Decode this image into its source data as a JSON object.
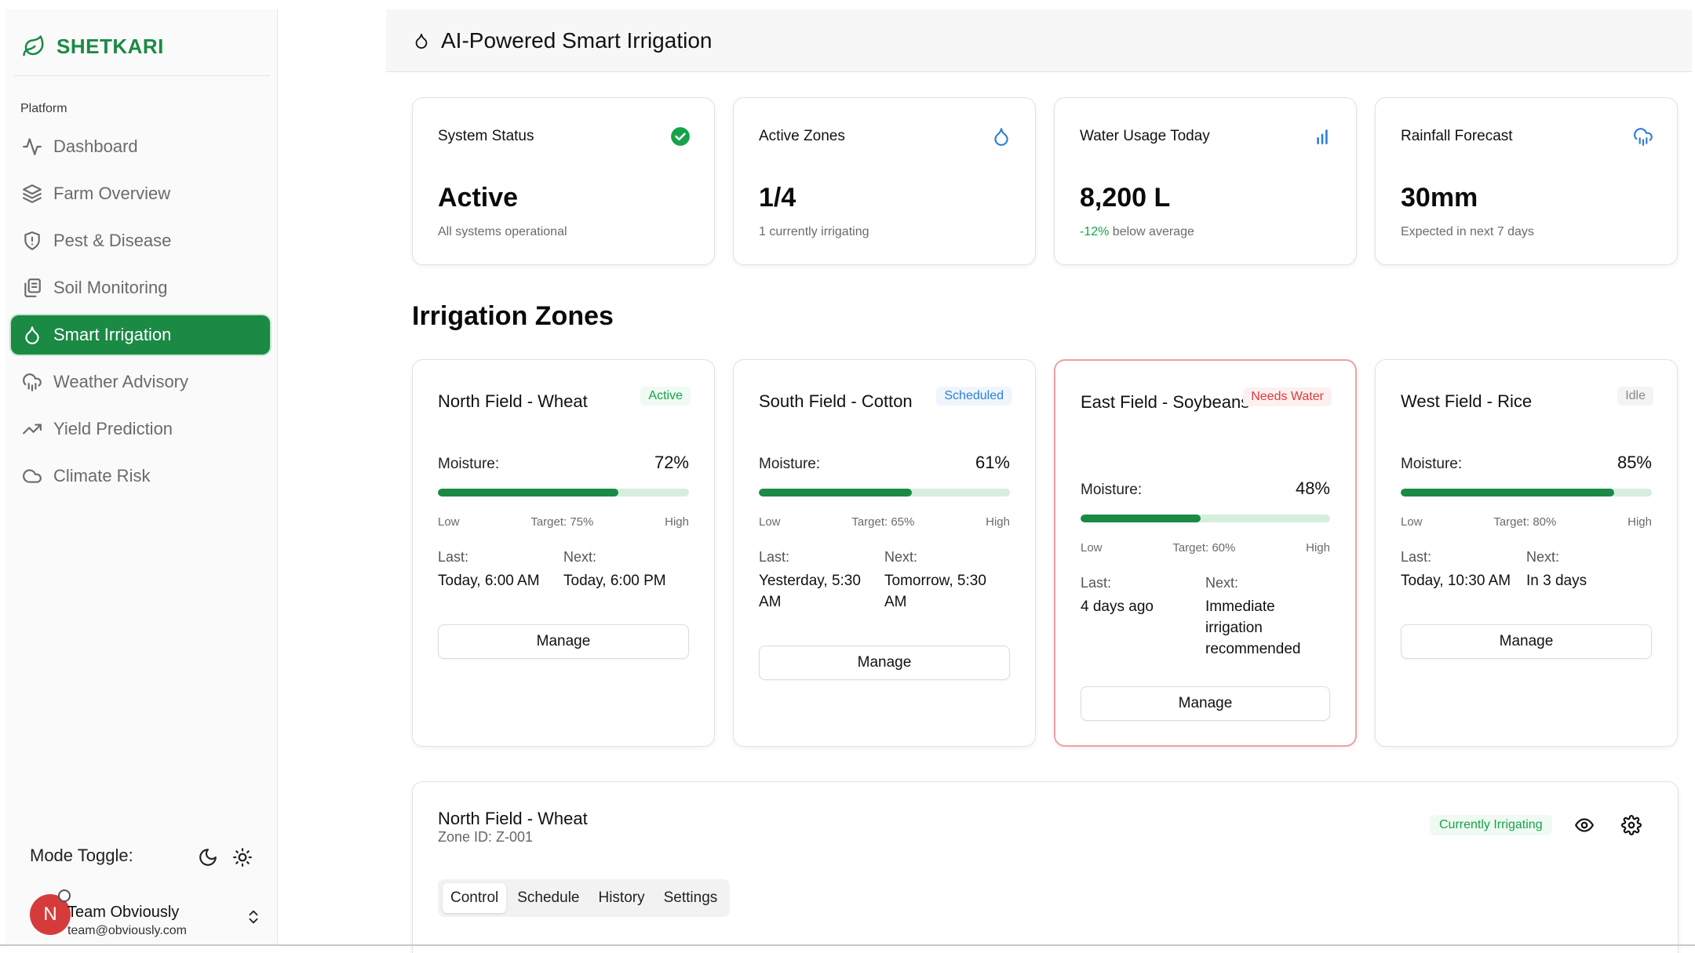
{
  "brand": {
    "name": "SHETKARI",
    "icon": "leaf-icon",
    "color": "#1a8a44"
  },
  "sidebar": {
    "group_label": "Platform",
    "items": [
      {
        "label": "Dashboard",
        "icon": "activity-icon"
      },
      {
        "label": "Farm Overview",
        "icon": "layers-icon"
      },
      {
        "label": "Pest & Disease",
        "icon": "shield-icon"
      },
      {
        "label": "Soil Monitoring",
        "icon": "copy-icon"
      },
      {
        "label": "Smart Irrigation",
        "icon": "droplet-icon",
        "active": true
      },
      {
        "label": "Weather Advisory",
        "icon": "cloud-rain-icon"
      },
      {
        "label": "Yield Prediction",
        "icon": "trending-up-icon"
      },
      {
        "label": "Climate Risk",
        "icon": "cloud-icon"
      }
    ],
    "mode_toggle_label": "Mode Toggle:",
    "user": {
      "initial": "N",
      "name": "Team Obviously",
      "email": "team@obviously.com"
    }
  },
  "header": {
    "title": "AI-Powered Smart Irrigation",
    "icon": "droplet-icon"
  },
  "stats": [
    {
      "title": "System Status",
      "value": "Active",
      "sub": "All systems operational",
      "icon": "check-circle-icon",
      "icon_color": "#16a34a"
    },
    {
      "title": "Active Zones",
      "value": "1/4",
      "sub": "1 currently irrigating",
      "icon": "droplet-icon",
      "icon_color": "#2f7fd4"
    },
    {
      "title": "Water Usage Today",
      "value": "8,200 L",
      "sub_highlight": "-12%",
      "sub": " below average",
      "icon": "bar-chart-icon",
      "icon_color": "#2f7fd4"
    },
    {
      "title": "Rainfall Forecast",
      "value": "30mm",
      "sub": "Expected in next 7 days",
      "icon": "cloud-rain-icon",
      "icon_color": "#2f7fd4"
    }
  ],
  "zones_title": "Irrigation Zones",
  "zones": [
    {
      "title": "North Field - Wheat",
      "badge": "Active",
      "moisture_label": "Moisture:",
      "moisture": "72%",
      "moisture_value": 72,
      "low": "Low",
      "target": "Target: 75%",
      "high": "High",
      "last_label": "Last:",
      "last": "Today, 6:00 AM",
      "next_label": "Next:",
      "next": "Today, 6:00 PM",
      "button": "Manage"
    },
    {
      "title": "South Field - Cotton",
      "badge": "Scheduled",
      "moisture_label": "Moisture:",
      "moisture": "61%",
      "moisture_value": 61,
      "low": "Low",
      "target": "Target: 65%",
      "high": "High",
      "last_label": "Last:",
      "last": "Yesterday, 5:30 AM",
      "next_label": "Next:",
      "next": "Tomorrow, 5:30 AM",
      "button": "Manage"
    },
    {
      "title": "East Field - Soybeans",
      "badge": "Needs Water",
      "moisture_label": "Moisture:",
      "moisture": "48%",
      "moisture_value": 48,
      "low": "Low",
      "target": "Target: 60%",
      "high": "High",
      "last_label": "Last:",
      "last": "4 days ago",
      "next_label": "Next:",
      "next": "Immediate irrigation recommended",
      "button": "Manage"
    },
    {
      "title": "West Field - Rice",
      "badge": "Idle",
      "moisture_label": "Moisture:",
      "moisture": "85%",
      "moisture_value": 85,
      "low": "Low",
      "target": "Target: 80%",
      "high": "High",
      "last_label": "Last:",
      "last": "Today, 10:30 AM",
      "next_label": "Next:",
      "next": "In 3 days",
      "button": "Manage"
    }
  ],
  "detail": {
    "title": "North Field - Wheat",
    "zone_id": "Zone ID: Z-001",
    "badge": "Currently Irrigating",
    "tabs": [
      "Control",
      "Schedule",
      "History",
      "Settings"
    ],
    "selected_tab": "Control"
  }
}
